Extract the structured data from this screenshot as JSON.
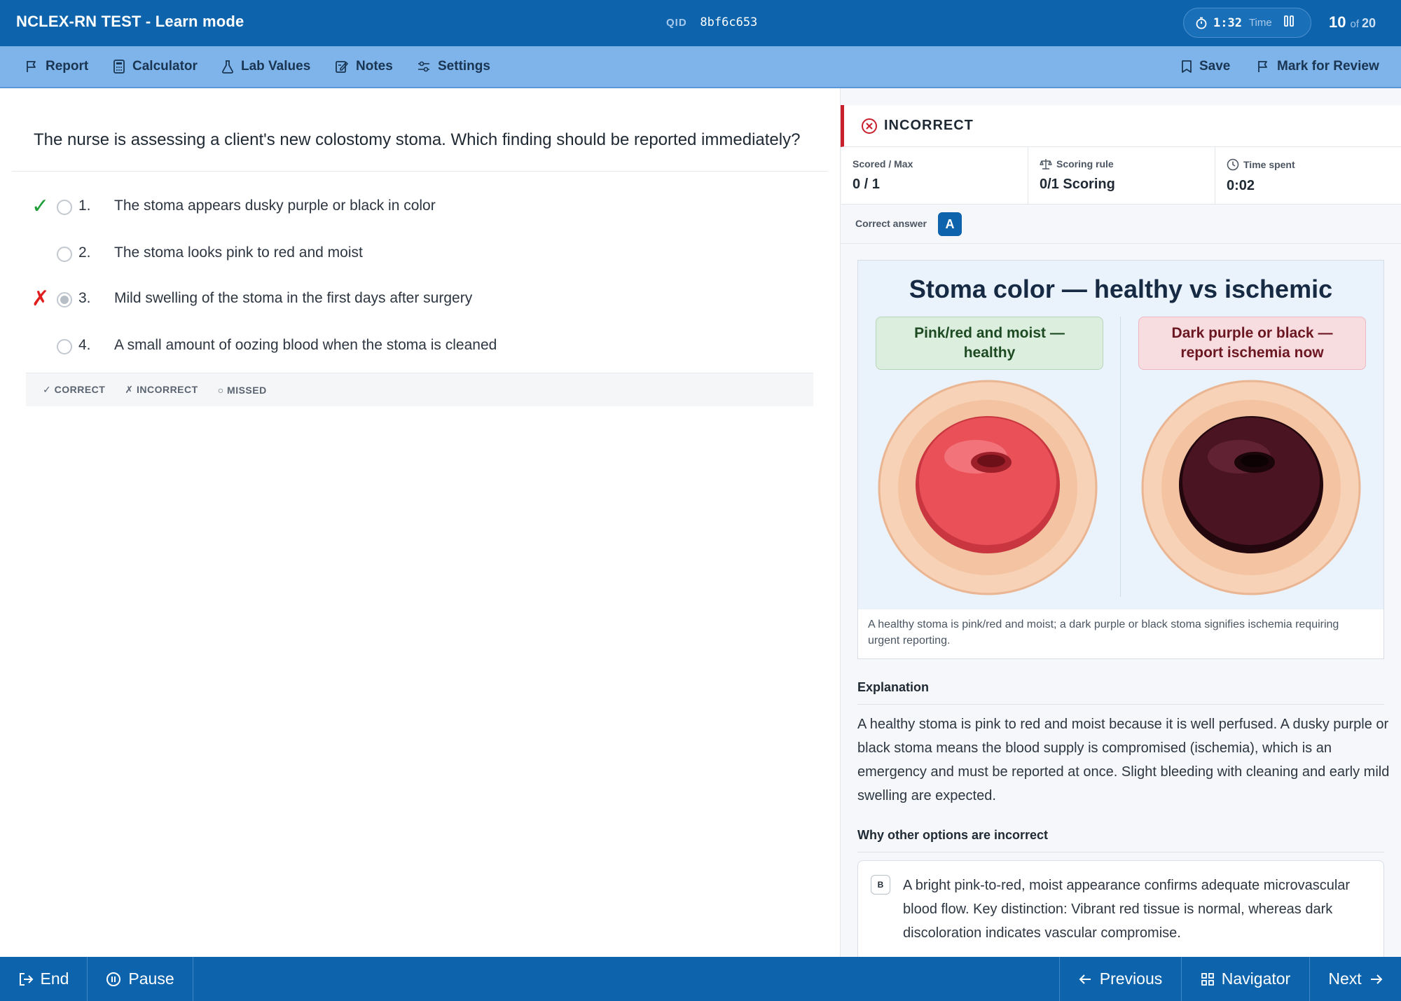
{
  "header": {
    "title": "NCLEX-RN TEST - Learn mode",
    "qid_label": "QID",
    "qid_value": "8bf6c653",
    "timer_value": "1:32",
    "timer_label": "Time",
    "question_number": "10",
    "question_of": "of",
    "question_total": "20"
  },
  "toolbar": {
    "report": "Report",
    "calculator": "Calculator",
    "lab_values": "Lab Values",
    "notes": "Notes",
    "settings": "Settings",
    "save": "Save",
    "mark_for_review": "Mark for Review"
  },
  "question": {
    "text": "The nurse is assessing a client's new colostomy stoma. Which finding should be reported immediately?",
    "options": [
      {
        "num": "1.",
        "text": "The stoma appears dusky purple or black in color",
        "mark": "✓",
        "status": "correct"
      },
      {
        "num": "2.",
        "text": "The stoma looks pink to red and moist",
        "mark": "",
        "status": "none"
      },
      {
        "num": "3.",
        "text": "Mild swelling of the stoma in the first days after surgery",
        "mark": "✗",
        "status": "incorrect"
      },
      {
        "num": "4.",
        "text": "A small amount of oozing blood when the stoma is cleaned",
        "mark": "",
        "status": "none"
      }
    ],
    "legend": {
      "correct": "✓ CORRECT",
      "incorrect": "✗ INCORRECT",
      "missed": "○ MISSED"
    }
  },
  "result": {
    "status": "INCORRECT",
    "scored_label": "Scored / Max",
    "scored_value": "0 / 1",
    "rule_label": "Scoring rule",
    "rule_value": "0/1 Scoring",
    "time_label": "Time spent",
    "time_value": "0:02",
    "correct_label": "Correct answer",
    "correct_value": "A"
  },
  "figure": {
    "title": "Stoma color — healthy vs ischemic",
    "left_label_1": "Pink/red and moist —",
    "left_label_2": "healthy",
    "right_label_1": "Dark purple or black —",
    "right_label_2": "report ischemia now",
    "caption": "A healthy stoma is pink/red and moist; a dark purple or black stoma signifies ischemia requiring urgent reporting."
  },
  "explanation": {
    "heading": "Explanation",
    "text": "A healthy stoma is pink to red and moist because it is well perfused. A dusky purple or black stoma means the blood supply is compromised (ischemia), which is an emergency and must be reported at once. Slight bleeding with cleaning and early mild swelling are expected.",
    "why_heading": "Why other options are incorrect",
    "why_items": [
      {
        "key": "B",
        "text": "A bright pink-to-red, moist appearance confirms adequate microvascular blood flow. Key distinction: Vibrant red tissue is normal, whereas dark discoloration indicates vascular compromise."
      }
    ]
  },
  "footer": {
    "end": "End",
    "pause": "Pause",
    "previous": "Previous",
    "navigator": "Navigator",
    "next": "Next"
  },
  "colors": {
    "header_bg": "#0d64ad",
    "toolbar_bg": "#7eb4e9",
    "correct": "#1e9e37",
    "incorrect": "#e01e1e",
    "healthy_stoma": "#e94b4f",
    "ischemic_stoma": "#3a0f1b"
  }
}
